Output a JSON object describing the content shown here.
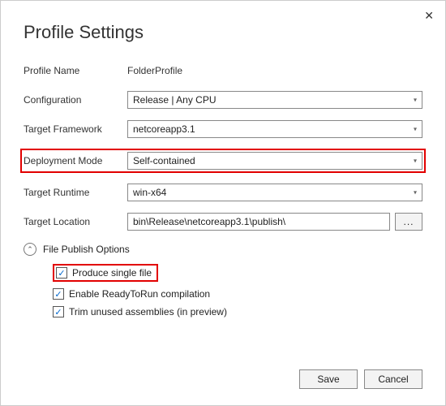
{
  "dialog": {
    "title": "Profile Settings",
    "close_glyph": "✕"
  },
  "fields": {
    "profileName": {
      "label": "Profile Name",
      "value": "FolderProfile"
    },
    "configuration": {
      "label": "Configuration",
      "value": "Release | Any CPU"
    },
    "targetFramework": {
      "label": "Target Framework",
      "value": "netcoreapp3.1"
    },
    "deploymentMode": {
      "label": "Deployment Mode",
      "value": "Self-contained"
    },
    "targetRuntime": {
      "label": "Target Runtime",
      "value": "win-x64"
    },
    "targetLocation": {
      "label": "Target Location",
      "value": "bin\\Release\\netcoreapp3.1\\publish\\"
    }
  },
  "browseLabel": "...",
  "expander": {
    "label": "File Publish Options",
    "glyph": "⌃"
  },
  "options": {
    "singleFile": {
      "label": "Produce single file",
      "checked": "✓"
    },
    "readyToRun": {
      "label": "Enable ReadyToRun compilation",
      "checked": "✓"
    },
    "trim": {
      "label": "Trim unused assemblies (in preview)",
      "checked": "✓"
    }
  },
  "buttons": {
    "save": "Save",
    "cancel": "Cancel"
  },
  "caret": "▾"
}
